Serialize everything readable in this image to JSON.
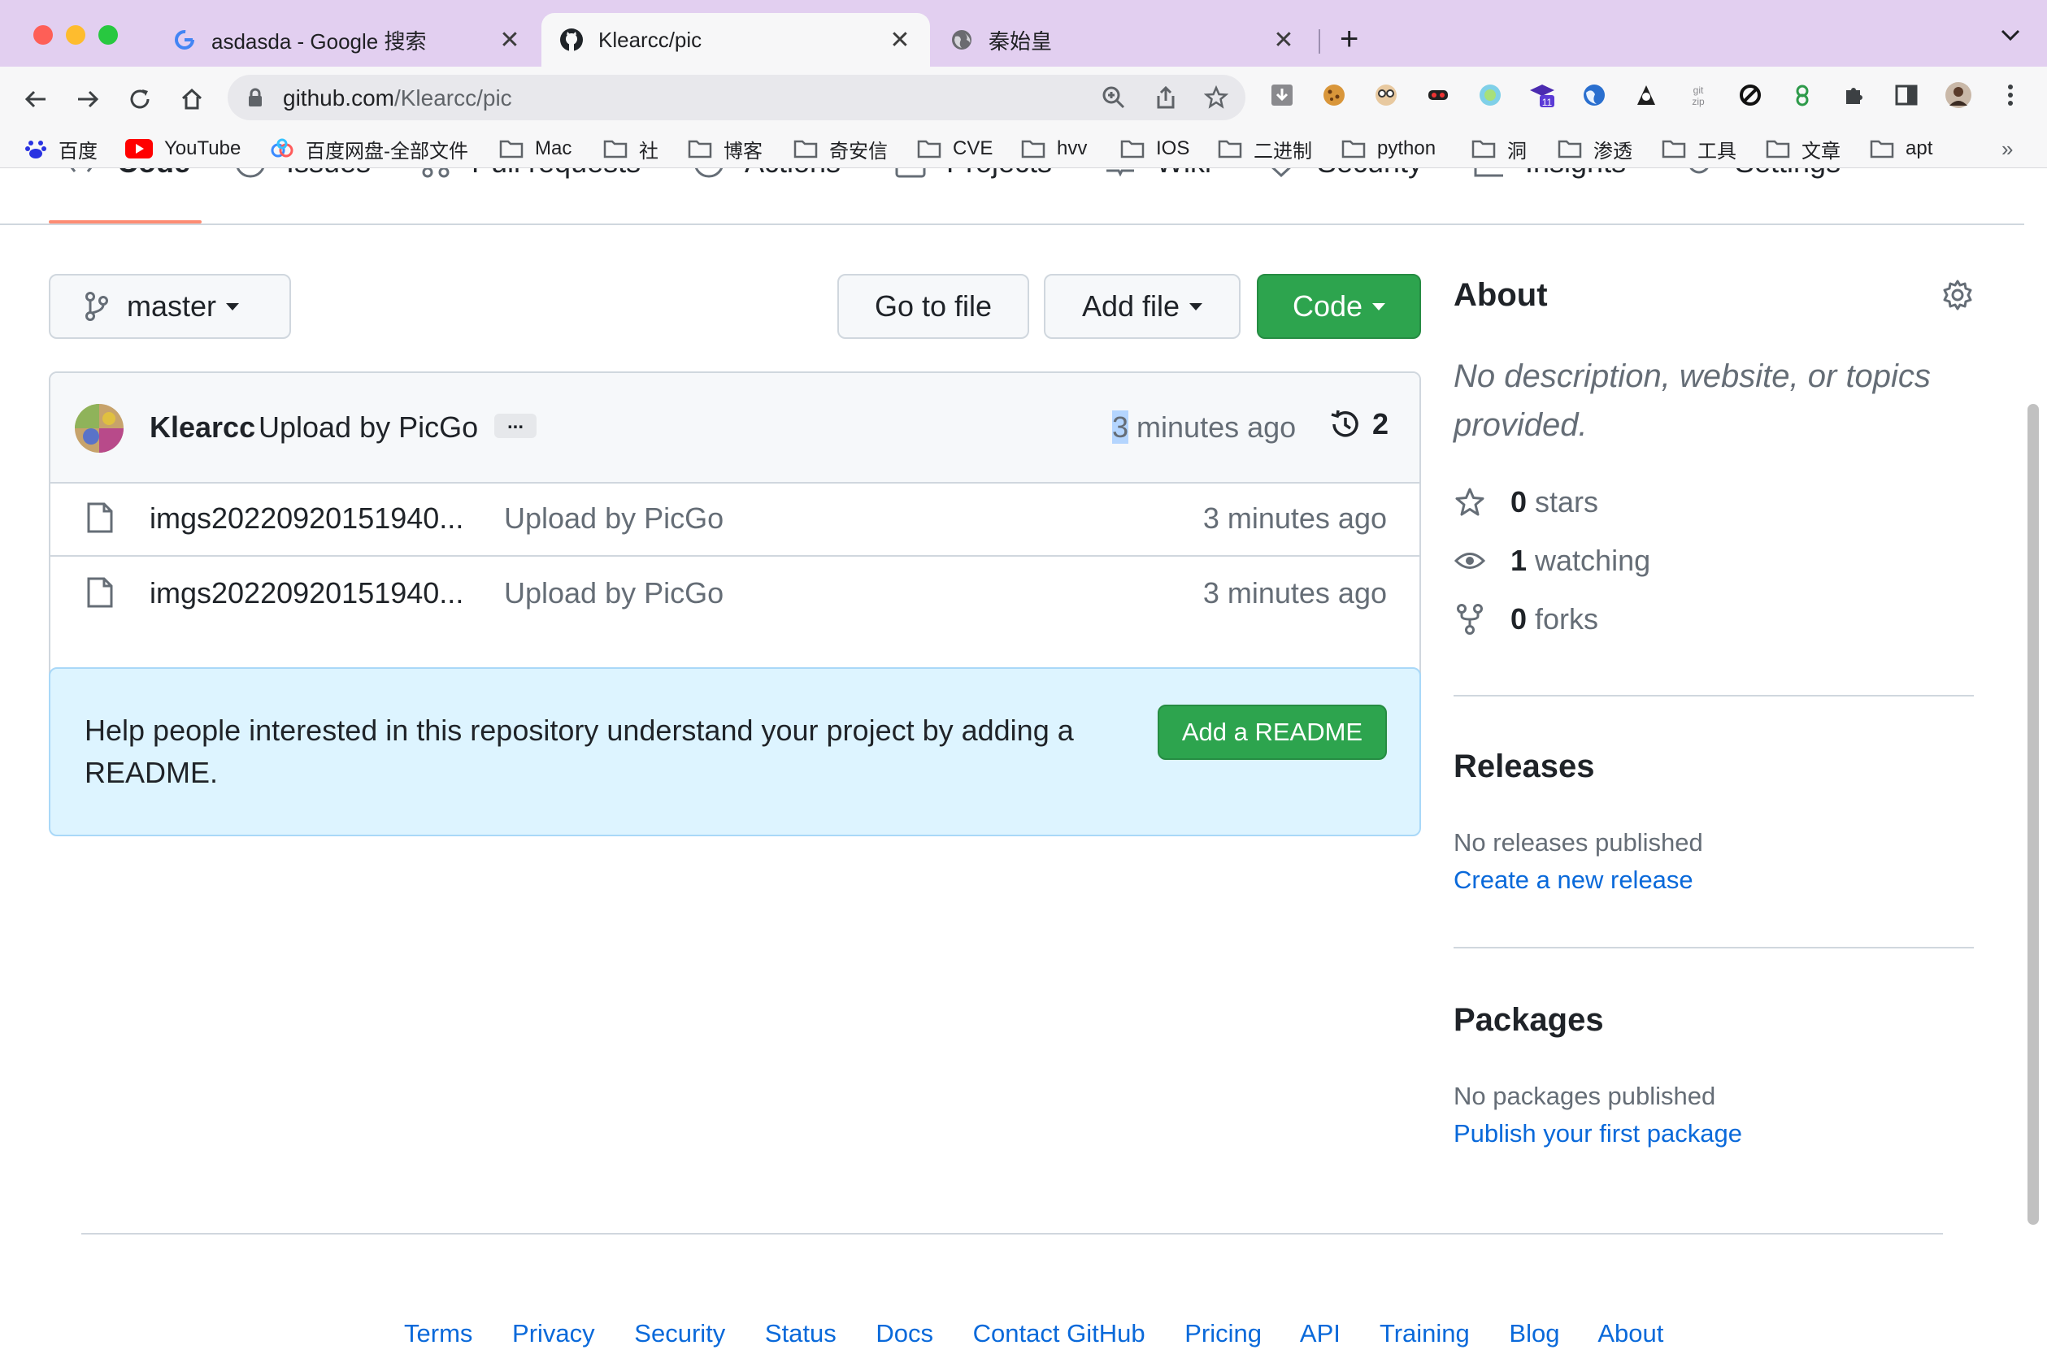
{
  "browser": {
    "tabs": [
      {
        "title": "asdasda - Google 搜索",
        "icon": "google-icon",
        "active": false
      },
      {
        "title": "Klearcc/pic",
        "icon": "github-icon",
        "active": true
      },
      {
        "title": "秦始皇",
        "icon": "globe-icon",
        "active": false
      }
    ],
    "url_host": "github.com",
    "url_path": "/Klearcc/pic",
    "extensions": [
      "download-icon",
      "cookie-icon",
      "face-icon",
      "mask-icon",
      "circle-ext-icon",
      "grad-cap-icon",
      "globe-ext-icon",
      "hacker-icon",
      "gitzip-icon",
      "block-icon",
      "leaf-icon",
      "puzzle-icon",
      "sidebar-icon",
      "profile-avatar",
      "menu-icon"
    ],
    "extension_badge": "11",
    "bookmarks": [
      {
        "label": "百度",
        "icon": "baidu-icon"
      },
      {
        "label": "YouTube",
        "icon": "youtube-icon"
      },
      {
        "label": "百度网盘-全部文件",
        "icon": "baidupan-icon"
      },
      {
        "label": "Mac",
        "icon": "folder-icon"
      },
      {
        "label": "社",
        "icon": "folder-icon"
      },
      {
        "label": "博客",
        "icon": "folder-icon"
      },
      {
        "label": "奇安信",
        "icon": "folder-icon"
      },
      {
        "label": "CVE",
        "icon": "folder-icon"
      },
      {
        "label": "hvv",
        "icon": "folder-icon"
      },
      {
        "label": "IOS",
        "icon": "folder-icon"
      },
      {
        "label": "二进制",
        "icon": "folder-icon"
      },
      {
        "label": "python",
        "icon": "folder-icon"
      },
      {
        "label": "洞",
        "icon": "folder-icon"
      },
      {
        "label": "渗透",
        "icon": "folder-icon"
      },
      {
        "label": "工具",
        "icon": "folder-icon"
      },
      {
        "label": "文章",
        "icon": "folder-icon"
      },
      {
        "label": "apt",
        "icon": "folder-icon"
      }
    ]
  },
  "repo_nav": {
    "tabs": [
      "Code",
      "Issues",
      "Pull requests",
      "Actions",
      "Projects",
      "Wiki",
      "Security",
      "Insights",
      "Settings"
    ]
  },
  "toolbar": {
    "branch": "master",
    "go_to_file": "Go to file",
    "add_file": "Add file",
    "code": "Code"
  },
  "latest_commit": {
    "author": "Klearcc",
    "message": "Upload by PicGo",
    "ellipsis": "...",
    "time_highlight": "3",
    "time_rest": " minutes ago",
    "commit_count": "2"
  },
  "files": [
    {
      "name": "imgs20220920151940...",
      "message": "Upload by PicGo",
      "time": "3 minutes ago"
    },
    {
      "name": "imgs20220920151940...",
      "message": "Upload by PicGo",
      "time": "3 minutes ago"
    }
  ],
  "readme_prompt": {
    "text": "Help people interested in this repository understand your project by adding a README.",
    "button": "Add a README"
  },
  "about": {
    "heading": "About",
    "description": "No description, website, or topics provided.",
    "stars_count": "0",
    "stars_label": "stars",
    "watching_count": "1",
    "watching_label": "watching",
    "forks_count": "0",
    "forks_label": "forks"
  },
  "releases": {
    "heading": "Releases",
    "status": "No releases published",
    "link": "Create a new release"
  },
  "packages": {
    "heading": "Packages",
    "status": "No packages published",
    "link": "Publish your first package"
  },
  "footer": {
    "links": [
      "Terms",
      "Privacy",
      "Security",
      "Status",
      "Docs",
      "Contact GitHub",
      "Pricing",
      "API",
      "Training",
      "Blog",
      "About"
    ]
  },
  "colors": {
    "tabstrip": "#e2cff0",
    "green_button": "#2da44e",
    "link_blue": "#0969da",
    "readme_bg": "#ddf4ff",
    "nav_underline": "#fd8c73"
  }
}
